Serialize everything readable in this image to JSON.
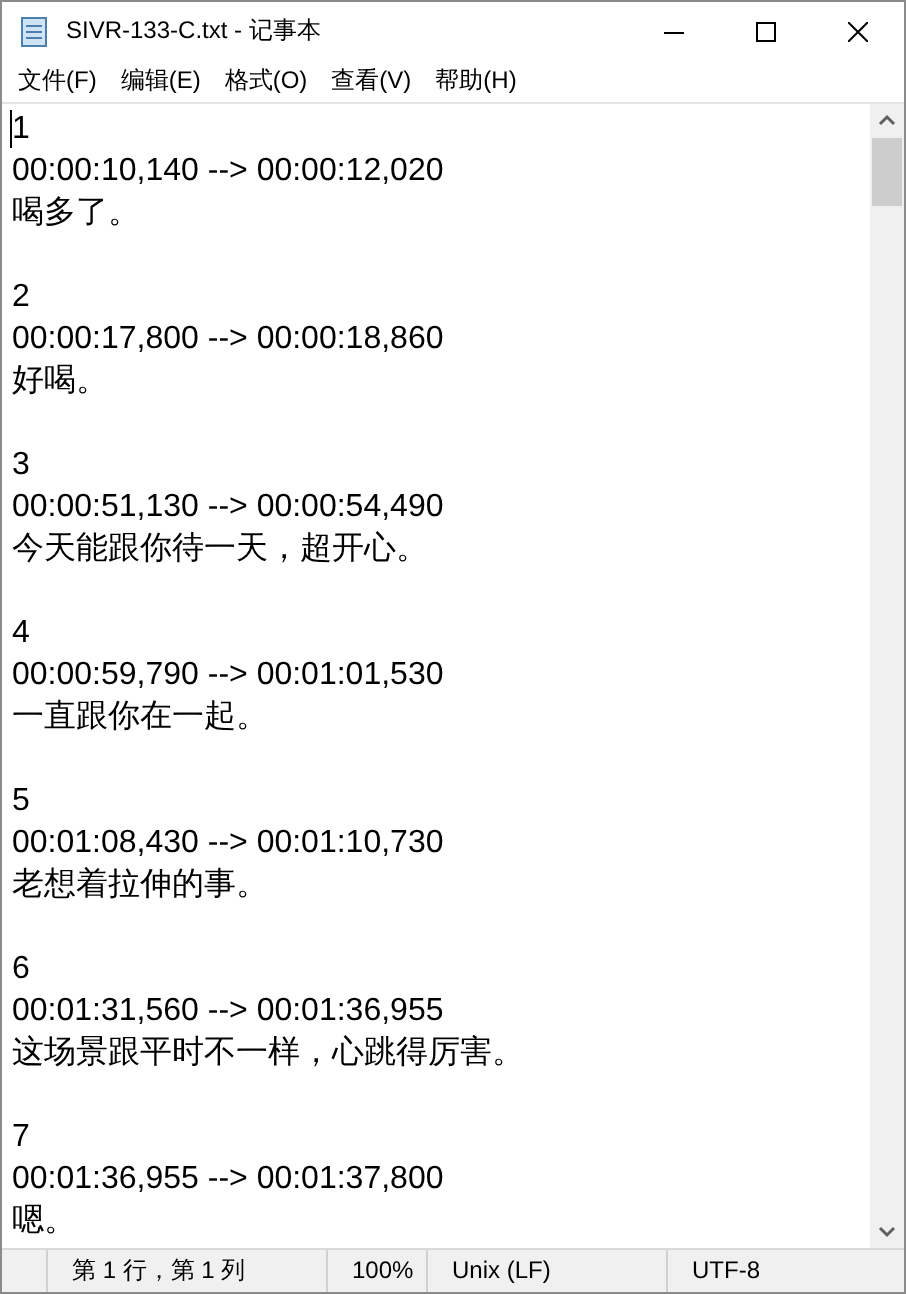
{
  "window": {
    "title": "SIVR-133-C.txt - 记事本"
  },
  "menu": [
    "文件(F)",
    "编辑(E)",
    "格式(O)",
    "查看(V)",
    "帮助(H)"
  ],
  "entries": [
    {
      "index": "1",
      "timing": "00:00:10,140 --> 00:00:12,020",
      "text": "喝多了。"
    },
    {
      "index": "2",
      "timing": "00:00:17,800 --> 00:00:18,860",
      "text": "好喝。"
    },
    {
      "index": "3",
      "timing": "00:00:51,130 --> 00:00:54,490",
      "text": "今天能跟你待一天，超开心。"
    },
    {
      "index": "4",
      "timing": "00:00:59,790 --> 00:01:01,530",
      "text": "一直跟你在一起。"
    },
    {
      "index": "5",
      "timing": "00:01:08,430 --> 00:01:10,730",
      "text": "老想着拉伸的事。"
    },
    {
      "index": "6",
      "timing": "00:01:31,560 --> 00:01:36,955",
      "text": "这场景跟平时不一样，心跳得厉害。"
    },
    {
      "index": "7",
      "timing": "00:01:36,955 --> 00:01:37,800",
      "text": "嗯。"
    }
  ],
  "status_bar": {
    "position": "第 1 行，第 1 列",
    "zoom": "100%",
    "line_ending": "Unix (LF)",
    "encoding": "UTF-8"
  }
}
